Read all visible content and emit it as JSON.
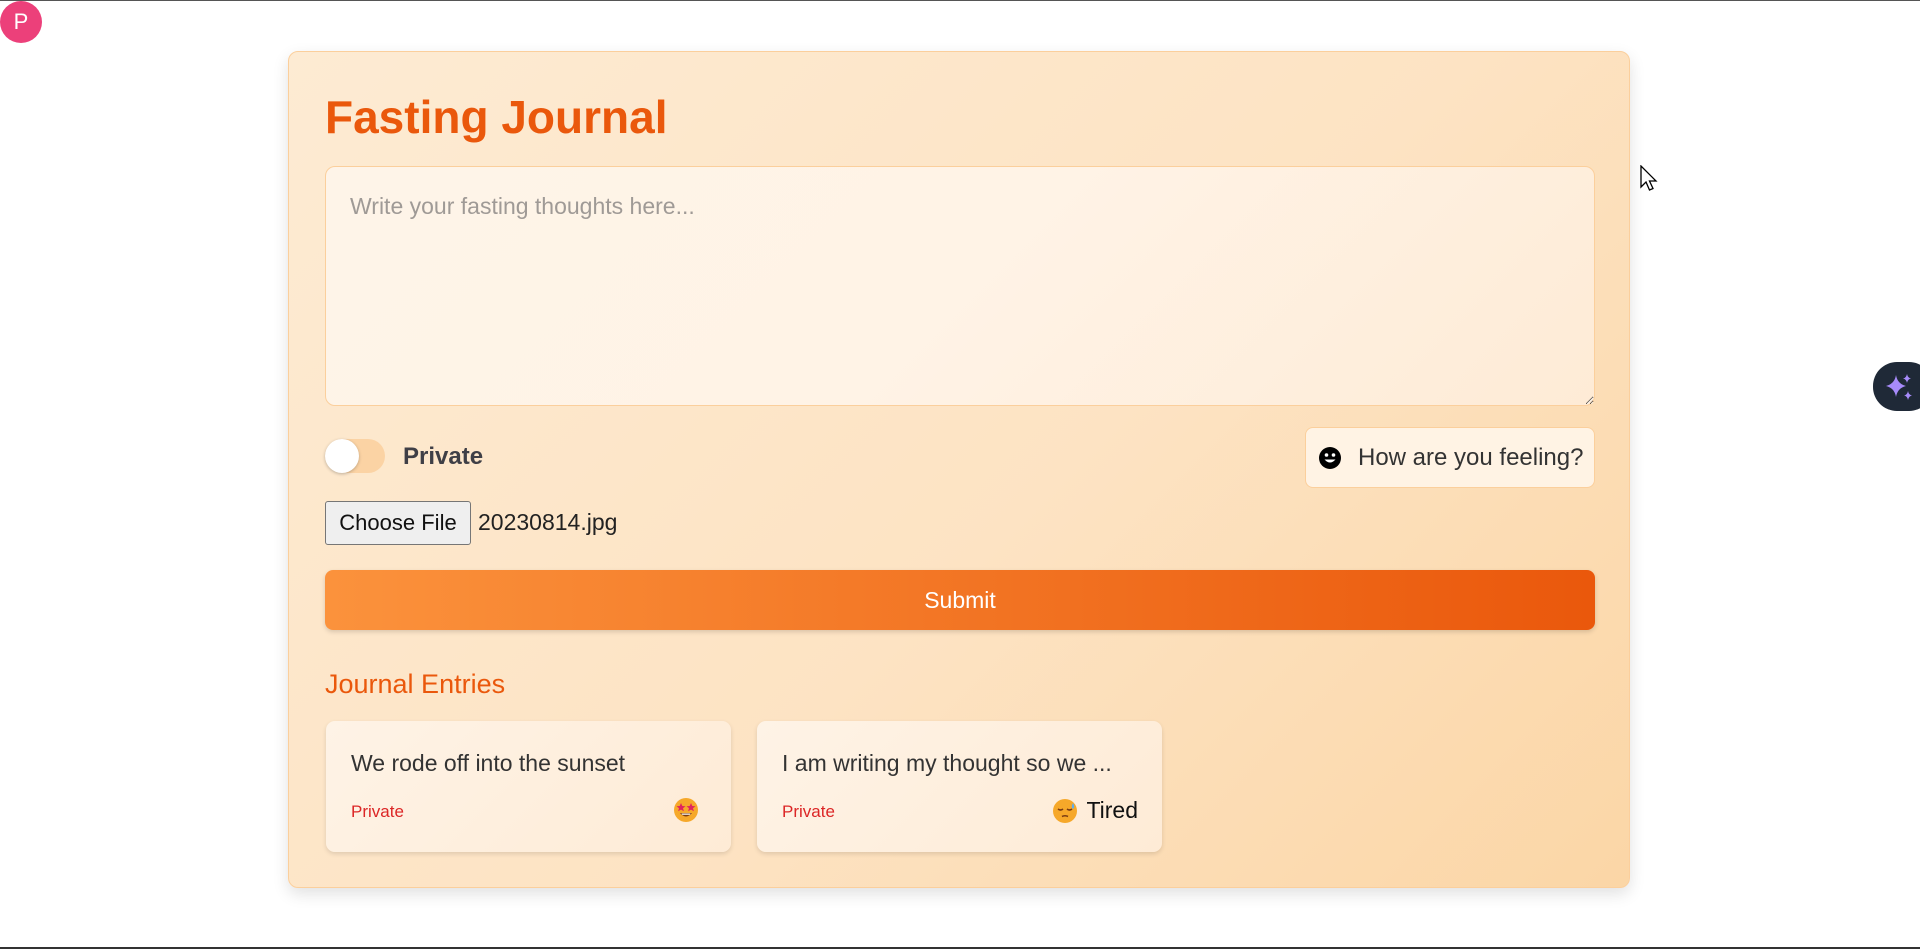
{
  "user": {
    "avatar_initial": "P"
  },
  "journal": {
    "title": "Fasting Journal",
    "thoughts_placeholder": "Write your fasting thoughts here...",
    "thoughts_value": "",
    "private_label": "Private",
    "private_toggle_on": false,
    "feeling_button_label": "How are you feeling?",
    "feeling_icon": "smiley-face-icon",
    "choose_file_label": "Choose File",
    "selected_file": "20230814.jpg",
    "submit_label": "Submit"
  },
  "entries_section": {
    "heading": "Journal Entries",
    "entries": [
      {
        "text": "We rode off into the sunset",
        "visibility": "Private",
        "mood_icon": "star-struck-emoji",
        "mood_label": ""
      },
      {
        "text": "I am writing my thought so we ...",
        "visibility": "Private",
        "mood_icon": "sleepy-face-emoji",
        "mood_label": "Tired"
      }
    ]
  },
  "side_widget": {
    "icon": "sparkles-icon"
  },
  "colors": {
    "accent": "#ea580c",
    "accent_light": "#fb923c",
    "card_bg": "#fde3c3",
    "private_text": "#dc2626",
    "avatar_bg": "#ec407a"
  }
}
